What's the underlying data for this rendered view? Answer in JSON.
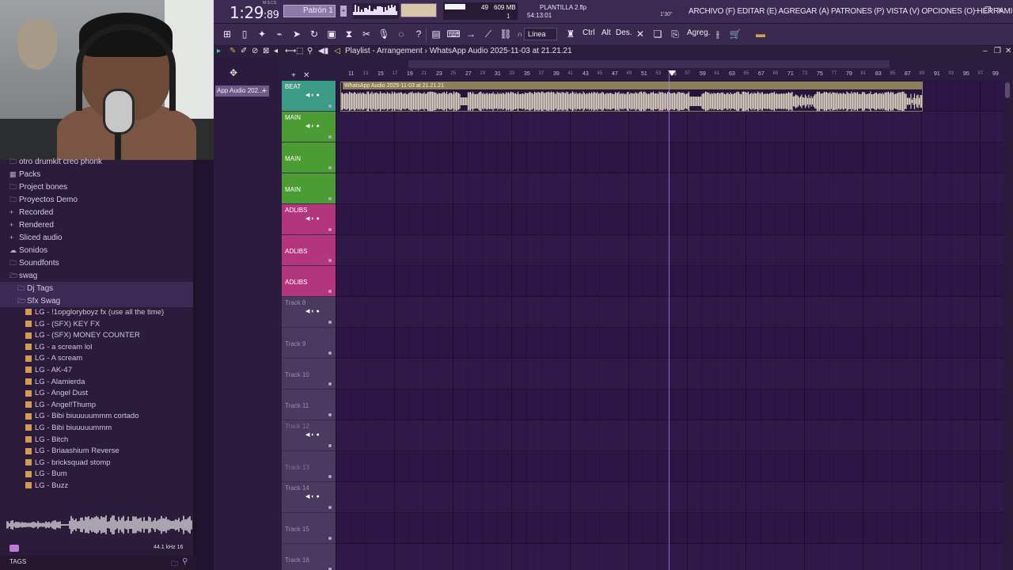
{
  "transport": {
    "time_main": "1:29",
    "time_sub": "89",
    "time_unit_label": "M:S:CS",
    "pattern_label": "Patrón 1"
  },
  "cpu": {
    "value": "49",
    "ram": "609 MB",
    "voices": "1"
  },
  "hint": {
    "project": "PLANTILLA 2.flp",
    "project_time": "54:13:01",
    "duration": "1'30\""
  },
  "menu": {
    "text": "ARCHIVO (F) EDITAR (E) AGREGAR (A) PATRONES (P) VISTA (V) OPCIONES (O) HERRAMIENTAS (T) AYUDA"
  },
  "toolbar": {
    "snap": "Línea",
    "ctrl": "Ctrl",
    "alt": "Alt",
    "des": "Des.",
    "agreg": "Agreg."
  },
  "playlist": {
    "title": "Playlist - Arrangement › WhatsApp Audio 2025-11-03 at 21.21.21",
    "clip_tab": "App Audio 202...",
    "clip_name": "WhatsApp Audio 2025-11-03 at 21.21.21"
  },
  "ruler": {
    "numbers": [
      "11",
      "13",
      "15",
      "17",
      "19",
      "21",
      "23",
      "25",
      "27",
      "29",
      "31",
      "33",
      "35",
      "37",
      "39",
      "41",
      "43",
      "45",
      "47",
      "49",
      "51",
      "53",
      "55",
      "57",
      "59",
      "61",
      "63",
      "65",
      "67",
      "69",
      "71",
      "73",
      "75",
      "77",
      "79",
      "81",
      "83",
      "85",
      "87",
      "89",
      "91",
      "93",
      "95",
      "97",
      "99"
    ]
  },
  "tracks": [
    {
      "name": "BEAT",
      "kind": "beat"
    },
    {
      "name": "MAIN",
      "kind": "main"
    },
    {
      "name": "MAIN",
      "kind": "main"
    },
    {
      "name": "MAIN",
      "kind": "main"
    },
    {
      "name": "ADLIBS",
      "kind": "adlib"
    },
    {
      "name": "ADLIBS",
      "kind": "adlib"
    },
    {
      "name": "ADLIBS",
      "kind": "adlib"
    },
    {
      "name": "Track 8",
      "kind": "empty"
    },
    {
      "name": "Track 9",
      "kind": "empty"
    },
    {
      "name": "Track 10",
      "kind": "empty"
    },
    {
      "name": "Track 11",
      "kind": "empty"
    },
    {
      "name": "Track 12",
      "kind": "dim"
    },
    {
      "name": "Track 13",
      "kind": "dim"
    },
    {
      "name": "Track 14",
      "kind": "empty"
    },
    {
      "name": "Track 15",
      "kind": "empty"
    },
    {
      "name": "Track 16",
      "kind": "empty"
    }
  ],
  "browser": {
    "items": [
      {
        "label": "otro drumkit creo phonk",
        "type": "folder"
      },
      {
        "label": "Packs",
        "type": "packs"
      },
      {
        "label": "Project bones",
        "type": "folder"
      },
      {
        "label": "Proyectos Demo",
        "type": "folder"
      },
      {
        "label": "Recorded",
        "type": "plus"
      },
      {
        "label": "Rendered",
        "type": "plus"
      },
      {
        "label": "Sliced audio",
        "type": "plus"
      },
      {
        "label": "Sonidos",
        "type": "cloud"
      },
      {
        "label": "Soundfonts",
        "type": "folder"
      },
      {
        "label": "swag",
        "type": "open"
      },
      {
        "label": "Dj Tags",
        "type": "sub"
      },
      {
        "label": "Sfx Swag",
        "type": "subopen"
      }
    ],
    "files": [
      "LG - !1opgloryboyz fx (use all the time)",
      "LG - (SFX) KEY FX",
      "LG - (SFX) MONEY COUNTER",
      "LG - a scream lol",
      "LG - A scream",
      "LG - AK-47",
      "LG - Alamierda",
      "LG - Angel Dust",
      "LG - Angel!Thump",
      "LG - Bibi biuuuuummm cortado",
      "LG - Bibi biuuuuummm",
      "LG - Bitch",
      "LG - Briaashium Reverse",
      "LG - bricksquad stomp",
      "LG - Bum",
      "LG - Buzz"
    ],
    "preview_info": "44.1 kHz 16",
    "tags_label": "TAGS"
  }
}
